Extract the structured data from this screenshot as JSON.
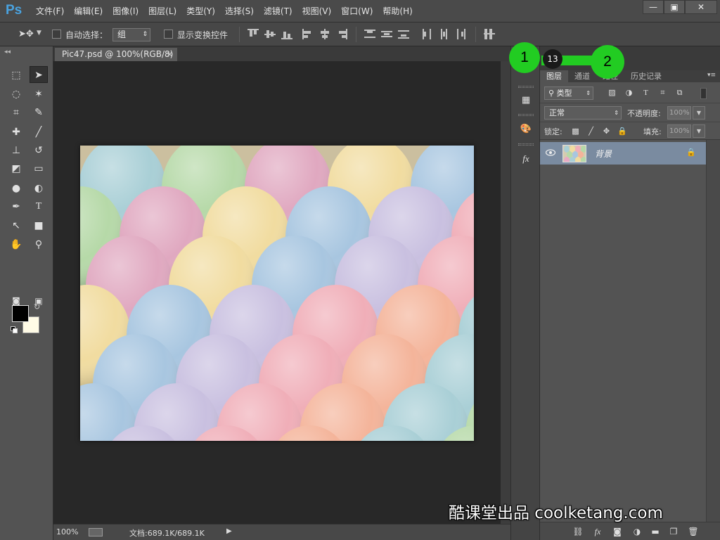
{
  "app": {
    "logo": "Ps"
  },
  "menu": [
    "文件(F)",
    "编辑(E)",
    "图像(I)",
    "图层(L)",
    "类型(Y)",
    "选择(S)",
    "滤镜(T)",
    "视图(V)",
    "窗口(W)",
    "帮助(H)"
  ],
  "window_controls": {
    "minimize": "—",
    "maximize": "▣",
    "close": "✕"
  },
  "options": {
    "auto_select_label": "自动选择：",
    "auto_select_value": "组",
    "show_transform_label": "显示变换控件",
    "auto_select_checked": false,
    "show_transform_checked": false
  },
  "document": {
    "tab_title": "Pic47.psd @ 100%(RGB/8)",
    "tab_close": "✕",
    "zoom": "100%",
    "doc_size": "文档:689.1K/689.1K"
  },
  "panels": {
    "tabs": [
      "图层",
      "通道",
      "路径",
      "历史记录"
    ],
    "active_tab": "图层",
    "filter_kind": "类型",
    "blend_mode": "正常",
    "opacity_label": "不透明度:",
    "opacity_value": "100%",
    "lock_label": "锁定:",
    "fill_label": "填充:",
    "fill_value": "100%",
    "layers": [
      {
        "name": "背景",
        "visible": true,
        "locked": true
      }
    ]
  },
  "overlay": {
    "marker_1": "1",
    "marker_2": "2",
    "step_badge": "13",
    "watermark": "酷课堂出品 coolketang.com"
  },
  "colors": {
    "foreground": "#000000",
    "background": "#fffbe6",
    "marker_green": "#22cc22",
    "layer_selected": "#7a8ba0"
  }
}
